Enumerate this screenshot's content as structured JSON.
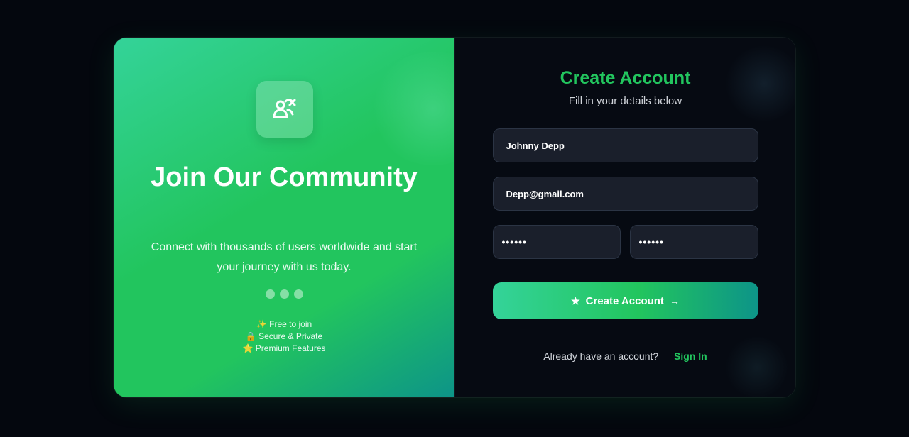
{
  "theme": {
    "accent": "#22c55e",
    "accent_light": "#34d399",
    "accent_dark": "#0d9488",
    "background": "#04070e",
    "field_bg": "#1a1f2b"
  },
  "promo": {
    "logo_icon": "users-link-icon",
    "title": "Join Our Community",
    "subtitle": "Connect with thousands of users worldwide and start your journey with us today.",
    "carousel_dots": 3,
    "features": [
      {
        "icon": "sparkles-icon",
        "emoji": "✨",
        "label": "Free to join"
      },
      {
        "icon": "lock-icon",
        "emoji": "🔒",
        "label": "Secure & Private"
      },
      {
        "icon": "star-icon",
        "emoji": "⭐",
        "label": "Premium Features"
      }
    ]
  },
  "form": {
    "title": "Create Account",
    "subtitle": "Fill in your details below",
    "name_value": "Johnny Depp",
    "email_value": "Depp@gmail.com",
    "password_value": "••••••",
    "confirm_password_value": "••••••",
    "submit_label": "Create Account",
    "submit_icon": "star-icon",
    "submit_arrow_icon": "arrow-right-icon",
    "signin_prompt": "Already have an account?",
    "signin_link": "Sign In"
  }
}
